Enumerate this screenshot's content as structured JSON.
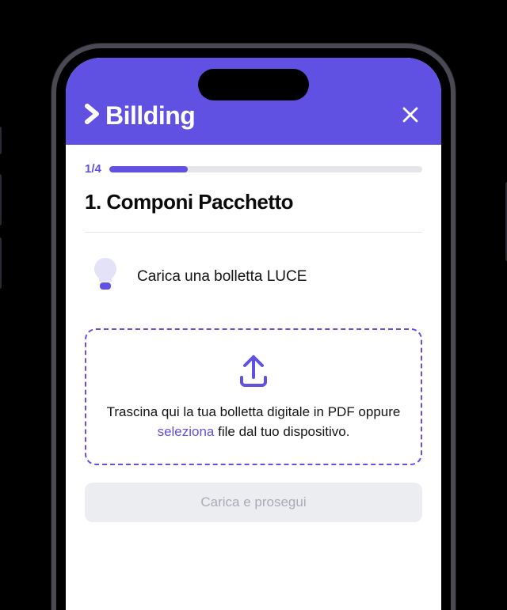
{
  "header": {
    "brand": "Billding",
    "close_label": "✕"
  },
  "progress": {
    "label": "1/4",
    "percent": 25
  },
  "title": "1. Componi Pacchetto",
  "hint": {
    "text": "Carica una bolletta LUCE"
  },
  "dropzone": {
    "text_before": "Trascina qui la tua bolletta digitale in PDF oppure ",
    "link_text": "seleziona",
    "text_after": " file dal tuo dispositivo."
  },
  "submit": {
    "label": "Carica e prosegui"
  },
  "colors": {
    "accent": "#6151e3"
  }
}
